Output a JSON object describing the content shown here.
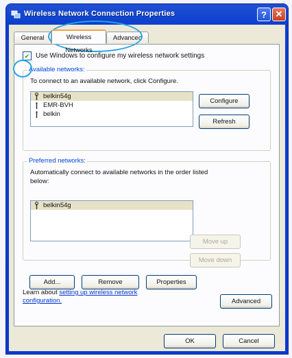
{
  "window": {
    "title": "Wireless Network Connection Properties",
    "help_glyph": "?",
    "close_glyph": "✕"
  },
  "tabs": [
    {
      "label": "General"
    },
    {
      "label": "Wireless Networks"
    },
    {
      "label": "Advanced"
    }
  ],
  "use_windows": {
    "checked": true,
    "label": "Use Windows to configure my wireless network settings"
  },
  "available": {
    "legend": "Available networks:",
    "description": "To connect to an available network, click Configure.",
    "networks": [
      "belkin54g",
      "EMR-BVH",
      "belkin"
    ],
    "configure_label": "Configure",
    "refresh_label": "Refresh"
  },
  "preferred": {
    "legend": "Preferred networks:",
    "description_line1": "Automatically connect to available networks in the order listed",
    "description_line2": "below:",
    "networks": [
      "belkin54g"
    ],
    "move_up_label": "Move up",
    "move_down_label": "Move down",
    "add_label": "Add...",
    "remove_label": "Remove",
    "properties_label": "Properties"
  },
  "learn": {
    "prefix": "Learn about ",
    "link_line1": "setting up wireless network",
    "link_line2": "configuration."
  },
  "advanced_label": "Advanced",
  "ok_label": "OK",
  "cancel_label": "Cancel",
  "colors": {
    "titlebar": "#0b3fce",
    "dialog_bg": "#ece9d8",
    "highlight_ring": "#2aa3e6",
    "group_legend": "#0046d5"
  }
}
